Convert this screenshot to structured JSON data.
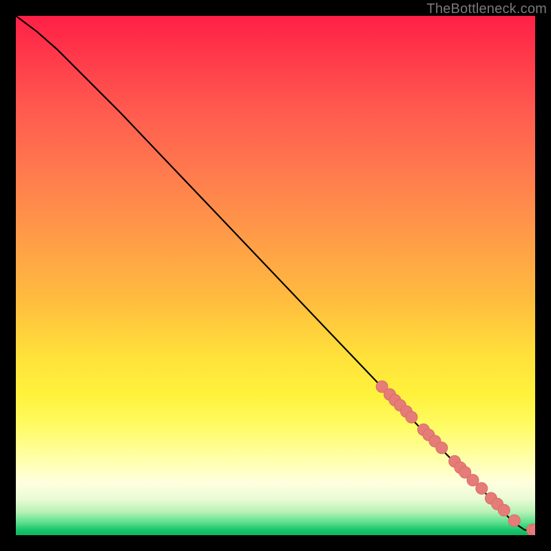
{
  "watermark": "TheBottleneck.com",
  "colors": {
    "dot_fill": "#e67c78",
    "dot_stroke": "#d86c68",
    "curve_stroke": "#000000",
    "background": "#000000"
  },
  "chart_data": {
    "type": "line",
    "title": "",
    "xlabel": "",
    "ylabel": "",
    "xlim": [
      0,
      100
    ],
    "ylim": [
      0,
      100
    ],
    "axes_visible": false,
    "grid": false,
    "legend": false,
    "series": [
      {
        "name": "curve",
        "kind": "line",
        "x": [
          0,
          4,
          8,
          12,
          16,
          20,
          30,
          40,
          50,
          60,
          70,
          78,
          82,
          86,
          90,
          93,
          95,
          96.5,
          98,
          99,
          100
        ],
        "y": [
          100,
          97,
          93.5,
          89.5,
          85.5,
          81.5,
          71,
          60.5,
          50,
          39.5,
          29,
          20.5,
          16.5,
          12.5,
          8.5,
          5.5,
          3.3,
          2.0,
          1.0,
          1.0,
          1.0
        ]
      },
      {
        "name": "highlighted-points",
        "kind": "scatter",
        "x": [
          70.5,
          72.0,
          73.0,
          74.0,
          75.2,
          76.2,
          78.5,
          79.5,
          80.7,
          82.0,
          84.5,
          85.6,
          86.5,
          88.0,
          89.7,
          91.5,
          92.7,
          94.0,
          96.0,
          99.5,
          100.0
        ],
        "y": [
          28.6,
          27.1,
          26.0,
          25.0,
          23.8,
          22.7,
          20.3,
          19.3,
          18.1,
          16.8,
          14.2,
          13.0,
          12.1,
          10.6,
          9.0,
          7.1,
          6.0,
          4.8,
          2.8,
          1.0,
          1.0
        ]
      }
    ]
  }
}
